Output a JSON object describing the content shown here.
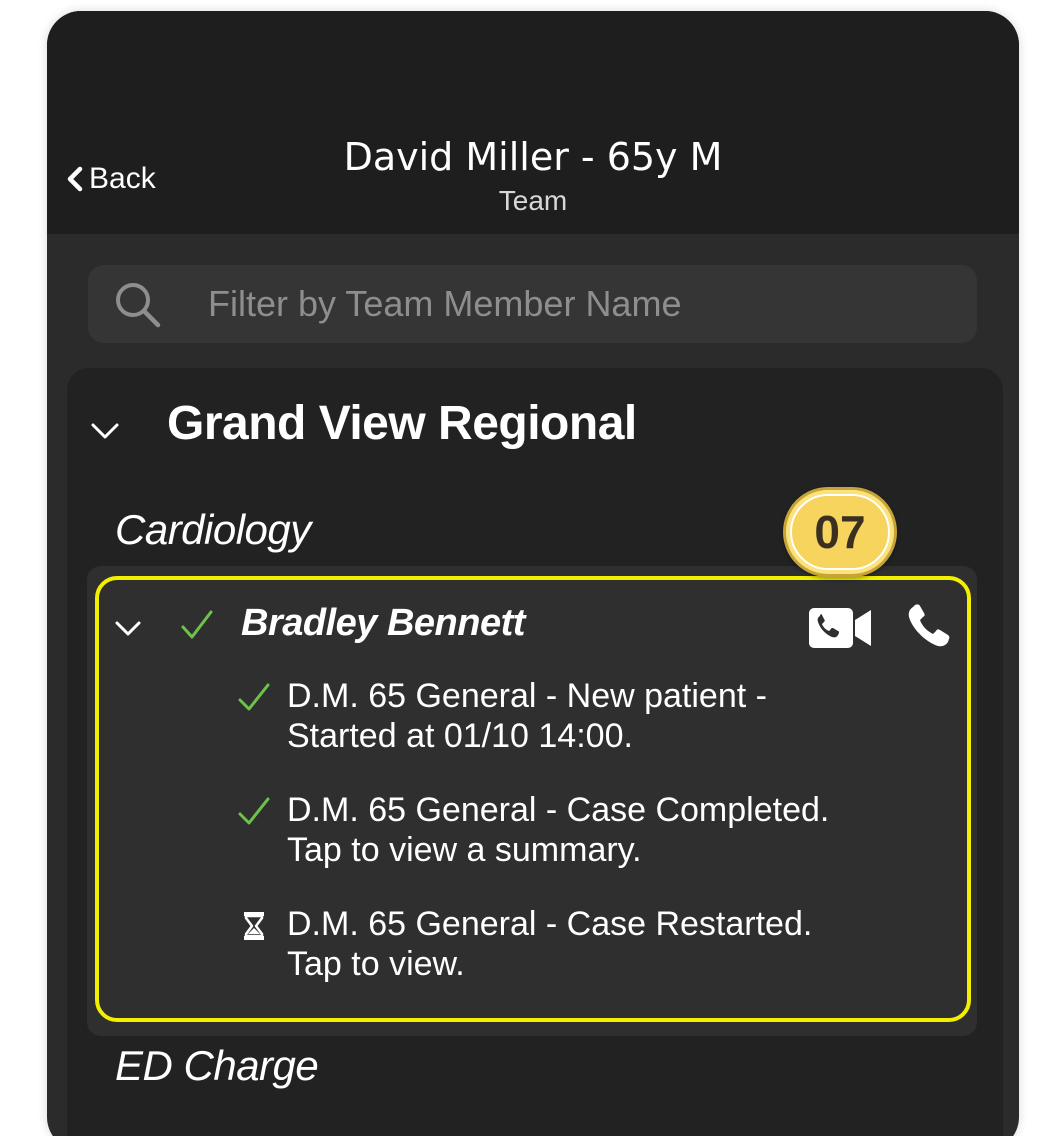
{
  "header": {
    "back_label": "Back",
    "title": "David Miller - 65y M",
    "subtitle": "Team"
  },
  "search": {
    "placeholder": "Filter by Team Member Name"
  },
  "group": {
    "name": "Grand View Regional",
    "departments": [
      {
        "name": "Cardiology",
        "members": [
          {
            "name": "Bradley Bennett",
            "status_icon": "check-icon",
            "actions": [
              "video-call-icon",
              "phone-icon"
            ],
            "tasks": [
              {
                "icon": "check-icon",
                "line1": "D.M. 65 General - New patient -",
                "line2": "Started at 01/10 14:00."
              },
              {
                "icon": "check-icon",
                "line1": "D.M. 65 General - Case Completed.",
                "line2": "Tap to view a summary."
              },
              {
                "icon": "hourglass-icon",
                "line1": "D.M. 65 General - Case Restarted.",
                "line2": "Tap to view."
              }
            ]
          }
        ]
      },
      {
        "name": "ED Charge",
        "members": []
      }
    ]
  },
  "callout": {
    "label": "07"
  },
  "colors": {
    "header_bg": "#1e1e1e",
    "body_bg": "#2b2b2b",
    "check_green": "#6cc24a",
    "highlight_yellow": "#f2f000",
    "badge_gold": "#f7d45e"
  }
}
